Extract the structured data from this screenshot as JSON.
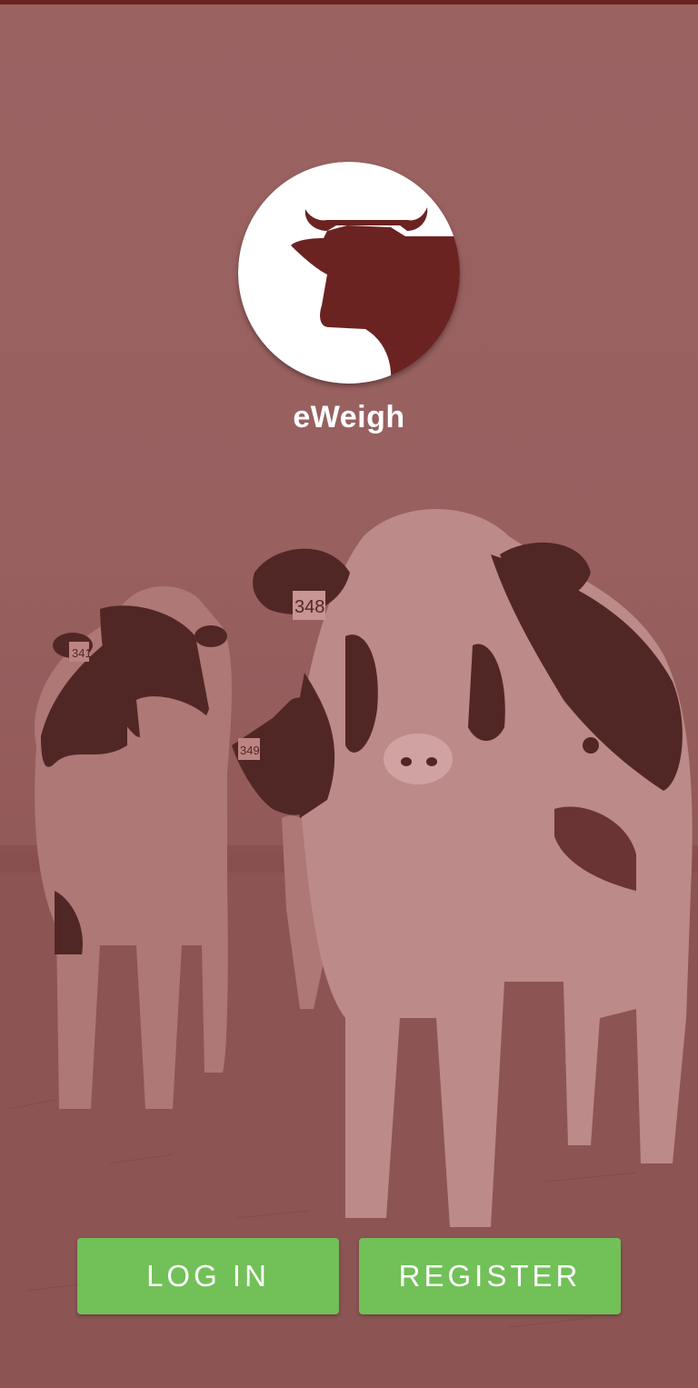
{
  "app": {
    "name": "eWeigh",
    "logo_icon": "cow-head-icon"
  },
  "actions": {
    "login_label": "LOG IN",
    "register_label": "REGISTER"
  },
  "background": {
    "tint_color": "#98605f",
    "ear_tags": [
      "341",
      "349",
      "348"
    ]
  },
  "colors": {
    "brand": "#6b2321",
    "button": "#72c058",
    "logo_bg": "#ffffff"
  }
}
